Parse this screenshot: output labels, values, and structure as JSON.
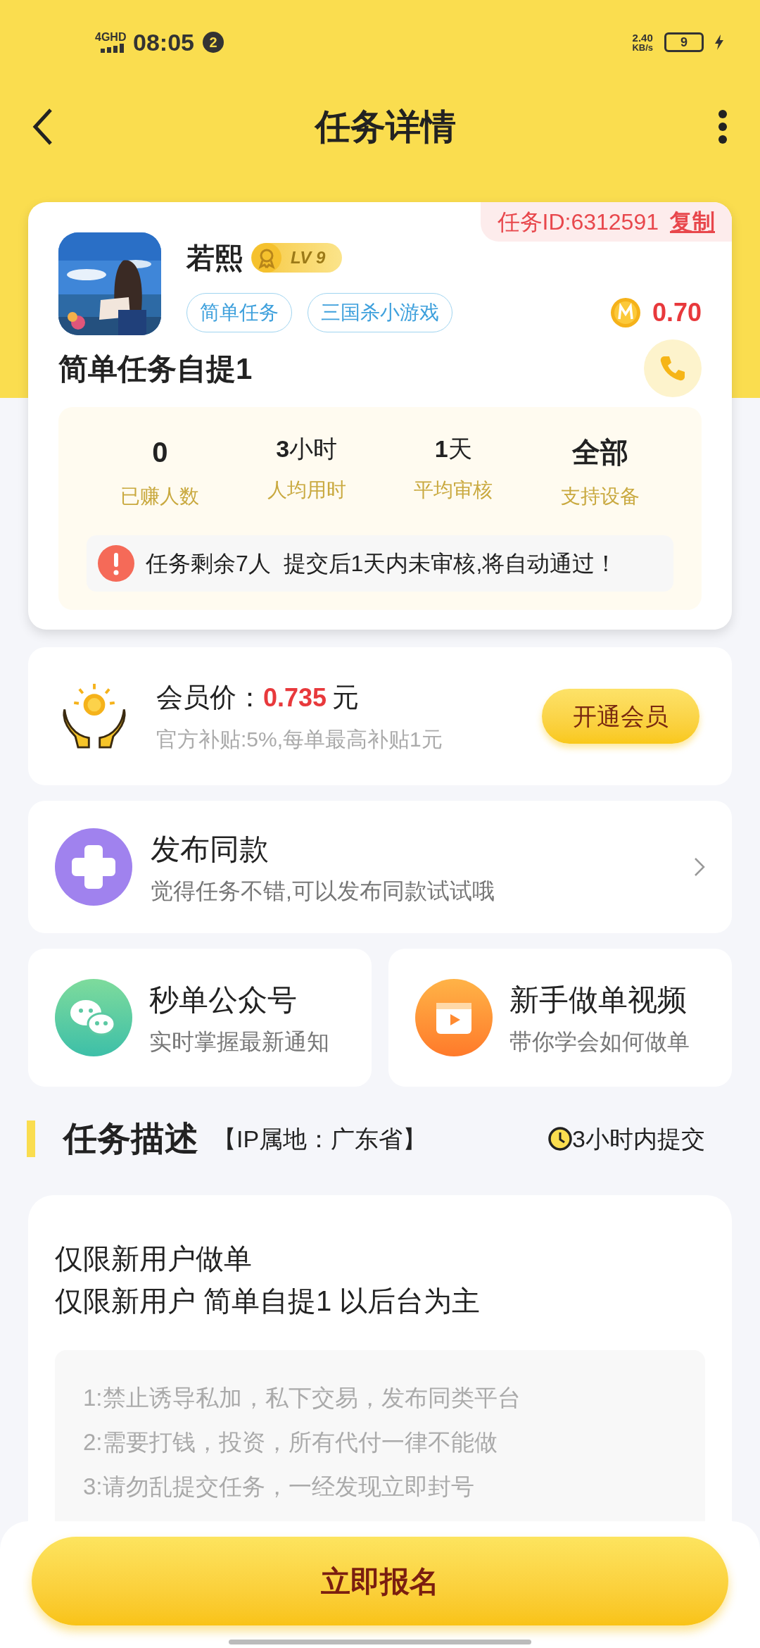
{
  "status_bar": {
    "network": "4GHD",
    "time": "08:05",
    "notification_count": "2",
    "speed_value": "2.40",
    "speed_unit": "KB/s",
    "battery": "9"
  },
  "header": {
    "title": "任务详情"
  },
  "task": {
    "id_label": "任务ID:6312591",
    "copy_link": "复制",
    "user_name": "若熙",
    "level": "LV 9",
    "tags": [
      "简单任务",
      "三国杀小游戏"
    ],
    "reward": "0.70",
    "title": "简单任务自提1",
    "stats": [
      {
        "value": "0",
        "label": "已赚人数"
      },
      {
        "value": "**3**小时",
        "label": "人均用时"
      },
      {
        "value": "**1**天",
        "label": "平均审核"
      },
      {
        "value": "全部",
        "label": "支持设备"
      }
    ],
    "notice": "任务剩余7人  提交后1天内未审核,将自动通过！"
  },
  "member": {
    "label": "会员价：",
    "price": "0.735",
    "unit": "元",
    "subsidy": "官方补贴:5%,每单最高补贴1元",
    "button": "开通会员"
  },
  "publish": {
    "title": "发布同款",
    "subtitle": "觉得任务不错,可以发布同款试试哦"
  },
  "shortcuts": [
    {
      "kind": "wechat",
      "title": "秒单公众号",
      "subtitle": "实时掌握最新通知"
    },
    {
      "kind": "video",
      "title": "新手做单视频",
      "subtitle": "带你学会如何做单"
    }
  ],
  "description": {
    "title": "任务描述",
    "ip": "【IP属地：广东省】",
    "deadline": "3小时内提交",
    "lines": [
      "仅限新用户做单",
      "仅限新用户 简单自提1 以后台为主"
    ],
    "rules": [
      "1:禁止诱导私加，私下交易，发布同类平台",
      "2:需要打钱，投资，所有代付一律不能做",
      "3:请勿乱提交任务，一经发现立即封号"
    ]
  },
  "bottom": {
    "button": "立即报名"
  }
}
